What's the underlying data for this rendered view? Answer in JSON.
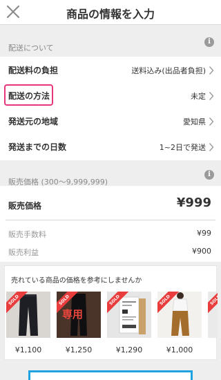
{
  "header": {
    "title": "商品の情報を入力"
  },
  "shipping": {
    "section_label": "配送について",
    "rows": [
      {
        "label": "配送料の負担",
        "value": "送料込み(出品者負担)"
      },
      {
        "label": "配送の方法",
        "value": "未定"
      },
      {
        "label": "発送元の地域",
        "value": "愛知県"
      },
      {
        "label": "発送までの日数",
        "value": "1~2日で発送"
      }
    ]
  },
  "pricing": {
    "section_label": "販売価格 (300〜9,999,999)",
    "price_label": "販売価格",
    "price_value": "¥999",
    "fee_label": "販売手数料",
    "fee_value": "¥99",
    "profit_label": "販売利益",
    "profit_value": "¥900"
  },
  "suggest": {
    "title": "売れている商品の価格を参考にしませんか",
    "sold_badge": "SOLD",
    "overlay_text": "専用",
    "items": [
      {
        "price": "¥1,100"
      },
      {
        "price": "¥1,250"
      },
      {
        "price": "¥1,290"
      },
      {
        "price": "¥1,000"
      }
    ]
  },
  "colors": {
    "accent_highlight": "#e8347a",
    "sold_ribbon": "#e93c3c",
    "button_border": "#1ea3e0"
  }
}
